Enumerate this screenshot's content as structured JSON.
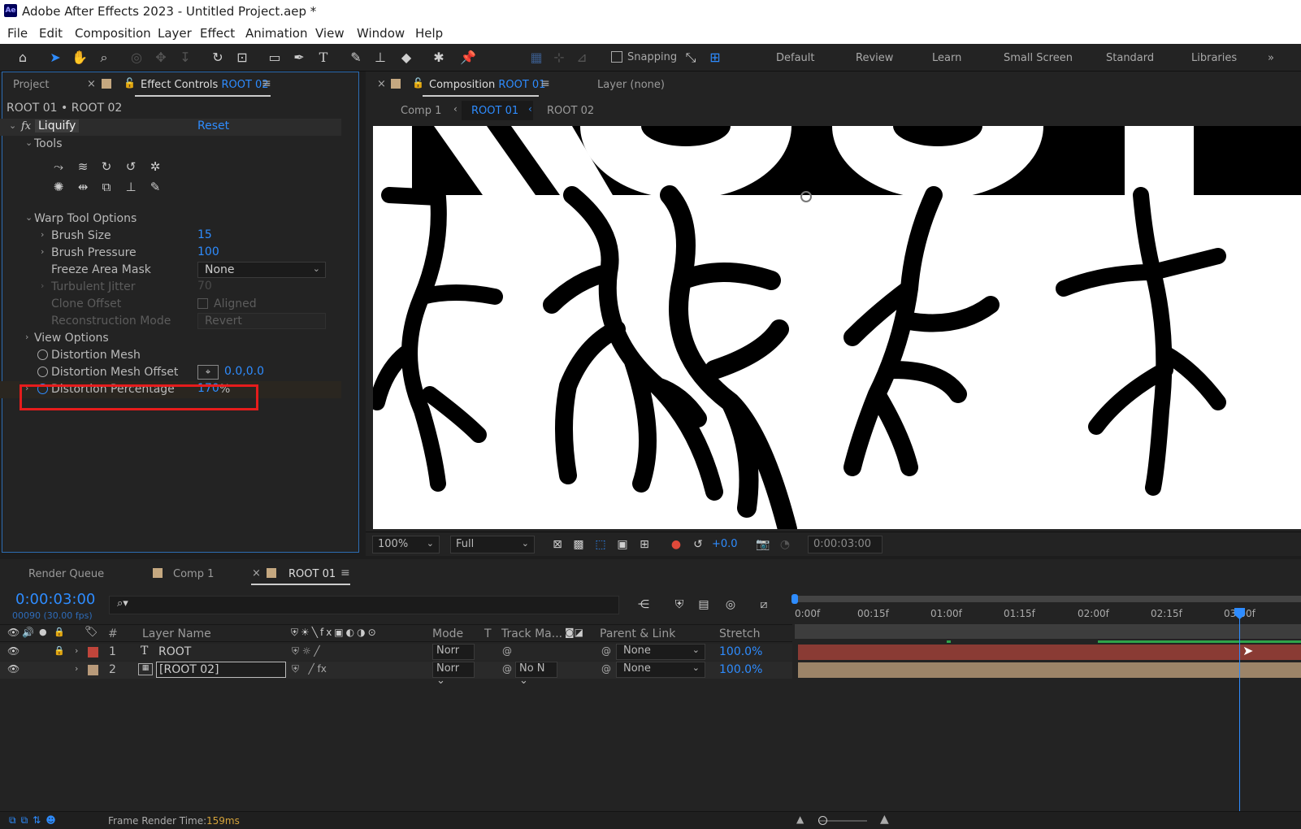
{
  "window": {
    "app_icon": "Ae",
    "title": "Adobe After Effects 2023 - Untitled Project.aep *"
  },
  "menu": [
    "File",
    "Edit",
    "Composition",
    "Layer",
    "Effect",
    "Animation",
    "View",
    "Window",
    "Help"
  ],
  "toolbar": {
    "snapping_label": "Snapping",
    "workspaces": [
      "Default",
      "Review",
      "Learn",
      "Small Screen",
      "Standard",
      "Libraries"
    ]
  },
  "left_panel": {
    "tab_project": "Project",
    "tab_effect_controls": "Effect Controls",
    "tab_effect_controls_target": "ROOT 02",
    "breadcrumb": "ROOT 01 • ROOT 02",
    "effect_name": "Liquify",
    "reset": "Reset",
    "tools_label": "Tools",
    "warp_tool_options": "Warp Tool Options",
    "brush_size_label": "Brush Size",
    "brush_size": "15",
    "brush_pressure_label": "Brush Pressure",
    "brush_pressure": "100",
    "freeze_area_mask_label": "Freeze Area Mask",
    "freeze_area_mask": "None",
    "turbulent_jitter_label": "Turbulent Jitter",
    "turbulent_jitter": "70",
    "clone_offset_label": "Clone Offset",
    "aligned_label": "Aligned",
    "reconstruction_mode_label": "Reconstruction Mode",
    "reconstruction_mode": "Revert",
    "view_options": "View Options",
    "distortion_mesh": "Distortion Mesh",
    "distortion_mesh_offset_label": "Distortion Mesh Offset",
    "distortion_mesh_offset": "0.0,0.0",
    "distortion_percentage_label": "Distortion Percentage",
    "distortion_percentage": "170",
    "percent_sign": "%"
  },
  "viewer": {
    "tab_composition": "Composition",
    "tab_composition_target": "ROOT 01",
    "tab_layer": "Layer (none)",
    "crumbs": [
      "Comp 1",
      "ROOT 01",
      "ROOT 02"
    ],
    "zoom": "100%",
    "resolution": "Full",
    "exposure": "+0.0",
    "timecode": "0:00:03:00"
  },
  "timeline": {
    "tabs": [
      "Render Queue",
      "Comp 1",
      "ROOT 01"
    ],
    "current_time": "0:00:03:00",
    "frames": "00090 (30.00 fps)",
    "ruler": [
      "0:00f",
      "00:15f",
      "01:00f",
      "01:15f",
      "02:00f",
      "02:15f",
      "03:00f"
    ],
    "columns": {
      "num": "#",
      "layer_name": "Layer Name",
      "mode": "Mode",
      "t": "T",
      "track_matte": "Track Ma...",
      "parent": "Parent & Link",
      "stretch": "Stretch"
    },
    "layers": [
      {
        "num": "1",
        "type": "T",
        "name": "ROOT",
        "mode": "Norr",
        "track": "",
        "parent": "None",
        "stretch": "100.0%",
        "label_color": "#c0453b"
      },
      {
        "num": "2",
        "type": "img",
        "name": "[ROOT 02]",
        "mode": "Norr",
        "track": "No N",
        "parent": "None",
        "stretch": "100.0%",
        "label_color": "#b89a7a"
      }
    ],
    "frame_render_label": "Frame Render Time:",
    "frame_render_value": "159ms"
  },
  "colors": {
    "accent": "#2e8cff",
    "highlight": "#e51c1c",
    "layer1_bar": "#8a3b34",
    "layer2_bar": "#9c8468"
  }
}
